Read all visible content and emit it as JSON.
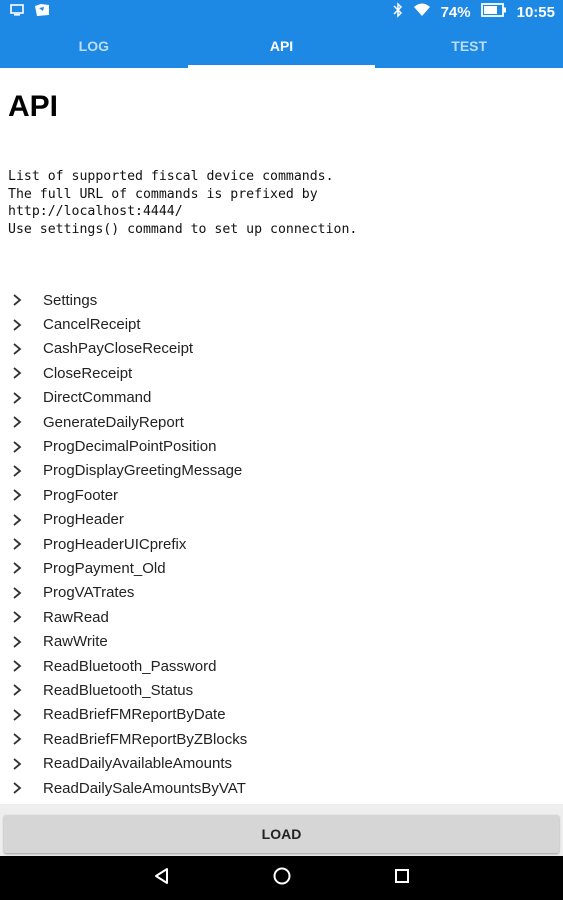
{
  "status_bar": {
    "battery": "74%",
    "time": "10:55"
  },
  "tabs": [
    {
      "label": "LOG",
      "active": false
    },
    {
      "label": "API",
      "active": true
    },
    {
      "label": "TEST",
      "active": false
    }
  ],
  "page": {
    "title": "API",
    "description": [
      "List of supported fiscal device commands.",
      "The full URL of commands is prefixed by",
      "http://localhost:4444/",
      "Use settings() command to set up connection."
    ]
  },
  "commands": [
    "Settings",
    "CancelReceipt",
    "CashPayCloseReceipt",
    "CloseReceipt",
    "DirectCommand",
    "GenerateDailyReport",
    "ProgDecimalPointPosition",
    "ProgDisplayGreetingMessage",
    "ProgFooter",
    "ProgHeader",
    "ProgHeaderUICprefix",
    "ProgPayment_Old",
    "ProgVATrates",
    "RawRead",
    "RawWrite",
    "ReadBluetooth_Password",
    "ReadBluetooth_Status",
    "ReadBriefFMReportByDate",
    "ReadBriefFMReportByZBlocks",
    "ReadDailyAvailableAmounts",
    "ReadDailySaleAmountsByVAT"
  ],
  "footer": {
    "load_label": "LOAD"
  },
  "colors": {
    "primary": "#1e88e5",
    "tab_inactive": "#bcdcf8"
  }
}
